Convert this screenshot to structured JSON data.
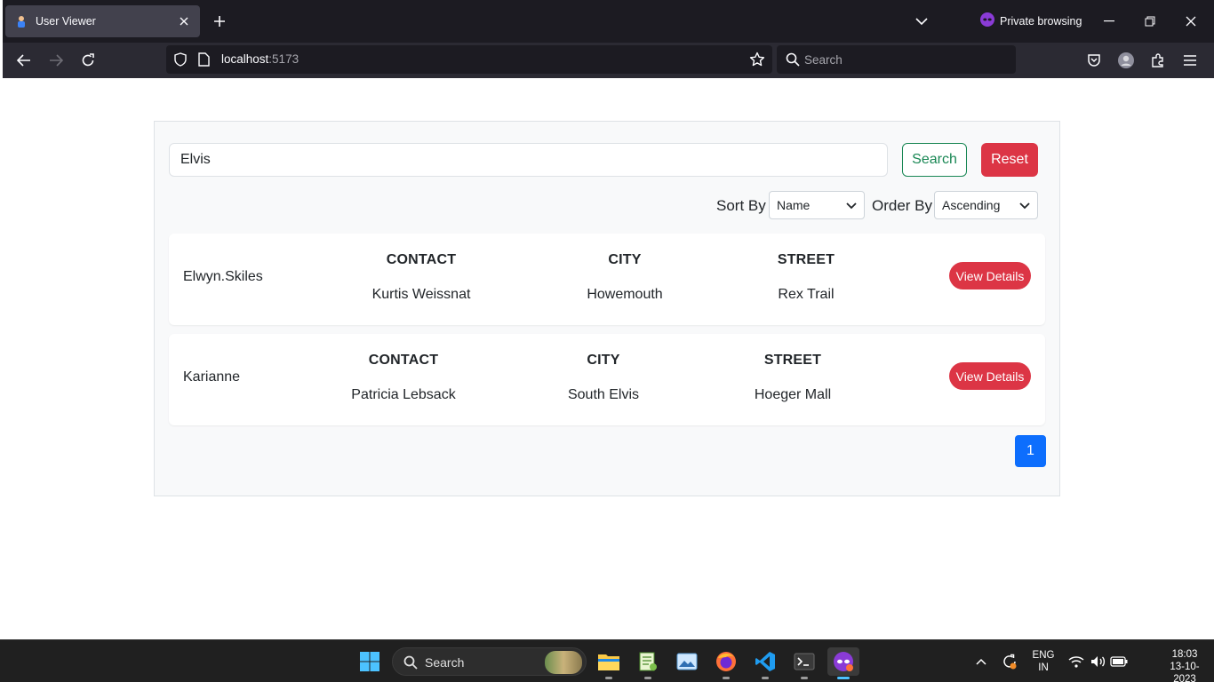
{
  "browser": {
    "tab_title": "User Viewer",
    "url_host": "localhost",
    "url_port": ":5173",
    "search_placeholder": "Search",
    "private_label": "Private browsing"
  },
  "search": {
    "value": "Elvis",
    "search_button": "Search",
    "reset_button": "Reset"
  },
  "sort": {
    "sort_label": "Sort By",
    "sort_value": "Name",
    "order_label": "Order By",
    "order_value": "Ascending"
  },
  "columns": {
    "contact": "CONTACT",
    "city": "CITY",
    "street": "STREET"
  },
  "users": [
    {
      "username": "Elwyn.Skiles",
      "contact": "Kurtis Weissnat",
      "city": "Howemouth",
      "street": "Rex Trail",
      "action": "View Details"
    },
    {
      "username": "Karianne",
      "contact": "Patricia Lebsack",
      "city": "South Elvis",
      "street": "Hoeger Mall",
      "action": "View Details"
    }
  ],
  "pagination": {
    "current_page": "1"
  },
  "taskbar": {
    "search_label": "Search",
    "lang_line1": "ENG",
    "lang_line2": "IN",
    "time": "18:03",
    "date": "13-10-2023"
  },
  "colors": {
    "primary": "#0d6efd",
    "success": "#198754",
    "danger": "#dc3545"
  }
}
